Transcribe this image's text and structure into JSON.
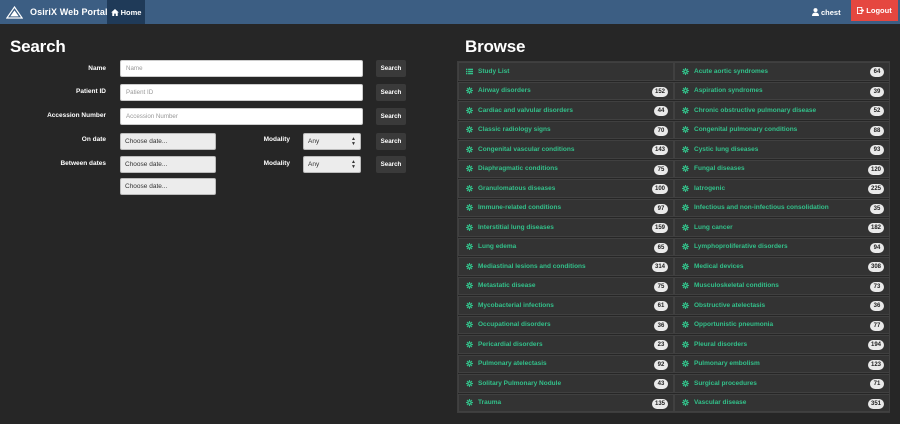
{
  "app": {
    "brand": "OsiriX Web Portal",
    "home": "Home",
    "user": "chest",
    "logout": "Logout",
    "colors": {
      "navbar": "#3c5e83",
      "logout": "#e54740",
      "accent": "#33c08a"
    }
  },
  "search": {
    "title": "Search",
    "name_label": "Name",
    "name_placeholder": "Name",
    "patient_label": "Patient ID",
    "patient_placeholder": "Patient ID",
    "accession_label": "Accession Number",
    "accession_placeholder": "Accession Number",
    "ondate_label": "On date",
    "between_label": "Between dates",
    "date_placeholder": "Choose date...",
    "modality_label": "Modality",
    "modality_value": "Any",
    "button": "Search"
  },
  "browse": {
    "title": "Browse",
    "left": [
      {
        "label": "Study List",
        "count": null,
        "icon": "list-icon"
      },
      {
        "label": "Airway disorders",
        "count": "152",
        "icon": "gear-icon"
      },
      {
        "label": "Cardiac and valvular disorders",
        "count": "44",
        "icon": "gear-icon"
      },
      {
        "label": "Classic radiology signs",
        "count": "70",
        "icon": "gear-icon"
      },
      {
        "label": "Congenital vascular conditions",
        "count": "143",
        "icon": "gear-icon"
      },
      {
        "label": "Diaphragmatic conditions",
        "count": "75",
        "icon": "gear-icon"
      },
      {
        "label": "Granulomatous diseases",
        "count": "100",
        "icon": "gear-icon"
      },
      {
        "label": "Immune-related conditions",
        "count": "97",
        "icon": "gear-icon"
      },
      {
        "label": "Interstitial lung diseases",
        "count": "159",
        "icon": "gear-icon"
      },
      {
        "label": "Lung edema",
        "count": "65",
        "icon": "gear-icon"
      },
      {
        "label": "Mediastinal lesions and conditions",
        "count": "314",
        "icon": "gear-icon"
      },
      {
        "label": "Metastatic disease",
        "count": "75",
        "icon": "gear-icon"
      },
      {
        "label": "Mycobacterial infections",
        "count": "61",
        "icon": "gear-icon"
      },
      {
        "label": "Occupational disorders",
        "count": "36",
        "icon": "gear-icon"
      },
      {
        "label": "Pericardial disorders",
        "count": "23",
        "icon": "gear-icon"
      },
      {
        "label": "Pulmonary atelectasis",
        "count": "92",
        "icon": "gear-icon"
      },
      {
        "label": "Solitary Pulmonary Nodule",
        "count": "43",
        "icon": "gear-icon"
      },
      {
        "label": "Trauma",
        "count": "135",
        "icon": "gear-icon"
      }
    ],
    "right": [
      {
        "label": "Acute aortic syndromes",
        "count": "64",
        "icon": "gear-icon"
      },
      {
        "label": "Aspiration syndromes",
        "count": "39",
        "icon": "gear-icon"
      },
      {
        "label": "Chronic obstructive pulmonary disease",
        "count": "52",
        "icon": "gear-icon"
      },
      {
        "label": "Congenital pulmonary conditions",
        "count": "88",
        "icon": "gear-icon"
      },
      {
        "label": "Cystic lung diseases",
        "count": "93",
        "icon": "gear-icon"
      },
      {
        "label": "Fungal diseases",
        "count": "120",
        "icon": "gear-icon"
      },
      {
        "label": "Iatrogenic",
        "count": "225",
        "icon": "gear-icon"
      },
      {
        "label": "Infectious and non-infectious consolidation",
        "count": "35",
        "icon": "gear-icon"
      },
      {
        "label": "Lung cancer",
        "count": "182",
        "icon": "gear-icon"
      },
      {
        "label": "Lymphoproliferative disorders",
        "count": "94",
        "icon": "gear-icon"
      },
      {
        "label": "Medical devices",
        "count": "308",
        "icon": "gear-icon"
      },
      {
        "label": "Musculoskeletal conditions",
        "count": "73",
        "icon": "gear-icon"
      },
      {
        "label": "Obstructive atelectasis",
        "count": "36",
        "icon": "gear-icon"
      },
      {
        "label": "Opportunistic pneumonia",
        "count": "77",
        "icon": "gear-icon"
      },
      {
        "label": "Pleural disorders",
        "count": "194",
        "icon": "gear-icon"
      },
      {
        "label": "Pulmonary embolism",
        "count": "123",
        "icon": "gear-icon"
      },
      {
        "label": "Surgical procedures",
        "count": "71",
        "icon": "gear-icon"
      },
      {
        "label": "Vascular disease",
        "count": "351",
        "icon": "gear-icon"
      }
    ]
  }
}
